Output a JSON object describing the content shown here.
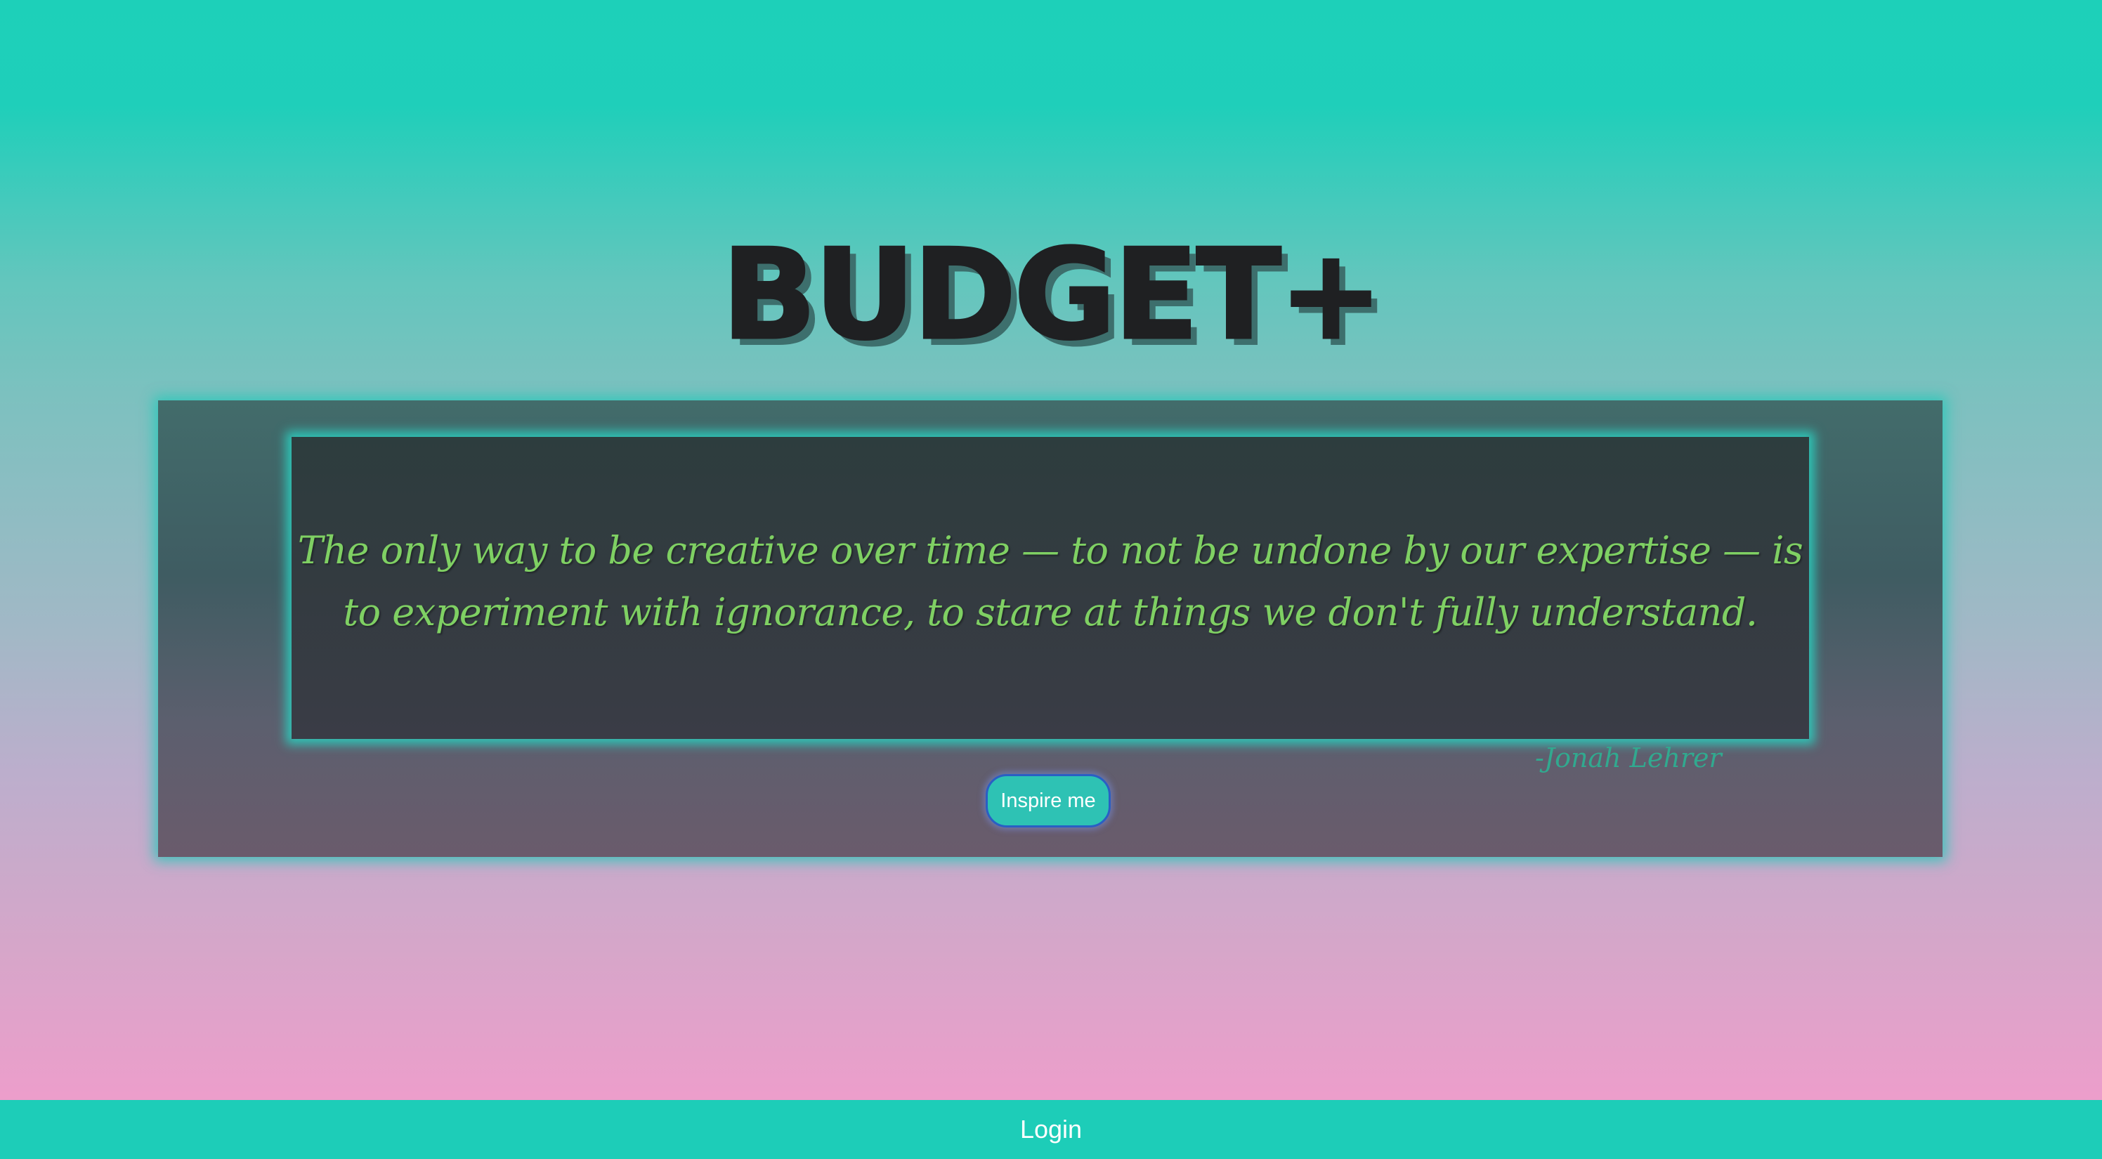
{
  "header": {
    "title": "BUDGET+"
  },
  "quote": {
    "text": "The only way to be creative over time — to not be undone by our expertise — is to experiment with ignorance, to stare at things we don't fully understand.",
    "author": "-Jonah Lehrer"
  },
  "actions": {
    "inspire_label": "Inspire me",
    "login_label": "Login"
  },
  "colors": {
    "accent": "#1dcdb8",
    "quote_text": "#7fd063",
    "author_text": "#31a98f",
    "title_text": "#1f2022"
  }
}
